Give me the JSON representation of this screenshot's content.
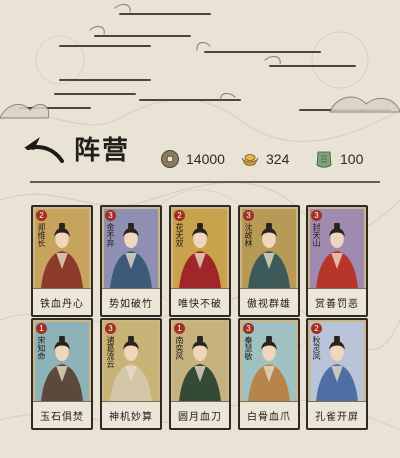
{
  "header": {
    "title": "阵营",
    "back_icon": "back-arrow-icon"
  },
  "resources": [
    {
      "icon": "copper-coin-icon",
      "value": "14000",
      "color": "#8b7d5c"
    },
    {
      "icon": "gold-ingot-icon",
      "value": "324",
      "color": "#c99a2e"
    },
    {
      "icon": "jade-token-icon",
      "value": "100",
      "color": "#7ea27c"
    }
  ],
  "colors": {
    "background": "#e9e3d6",
    "badge": "#a12f22",
    "frame": "#2f2a25"
  },
  "cards": [
    {
      "badge": "2",
      "name": "郑维长",
      "skill": "铁血丹心",
      "bg": "#c8a35d",
      "robe": "#8c3a2a"
    },
    {
      "badge": "3",
      "name": "金不弃",
      "skill": "势如破竹",
      "bg": "#8f8fb3",
      "robe": "#3d5a78"
    },
    {
      "badge": "2",
      "name": "花无双",
      "skill": "唯快不破",
      "bg": "#c9a24d",
      "robe": "#a1262a"
    },
    {
      "badge": "3",
      "name": "沈故林",
      "skill": "傲视群雄",
      "bg": "#b79a55",
      "robe": "#3e5a58"
    },
    {
      "badge": "3",
      "name": "封天山",
      "skill": "赏善罚恶",
      "bg": "#a08ab0",
      "robe": "#b8352b"
    },
    {
      "badge": "1",
      "name": "宋知命",
      "skill": "玉石俱焚",
      "bg": "#8db2b7",
      "robe": "#5b4a3c"
    },
    {
      "badge": "3",
      "name": "诸葛流云",
      "skill": "神机妙算",
      "bg": "#c8b377",
      "robe": "#d3c7a8"
    },
    {
      "badge": "1",
      "name": "南奕风",
      "skill": "圆月血刀",
      "bg": "#c6b27e",
      "robe": "#344a34"
    },
    {
      "badge": "3",
      "name": "秦慧敏",
      "skill": "白骨血爪",
      "bg": "#9fc1c1",
      "robe": "#b7854a"
    },
    {
      "badge": "2",
      "name": "秋灵凤",
      "skill": "孔雀开屏",
      "bg": "#b9c4d9",
      "robe": "#4f6fa4"
    }
  ]
}
